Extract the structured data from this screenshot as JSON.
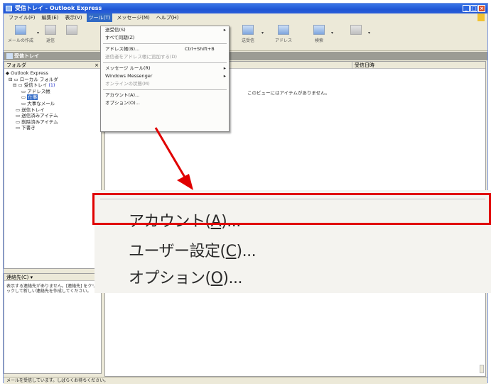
{
  "window": {
    "title": "受信トレイ - Outlook Express",
    "minimize": "_",
    "maximize": "□",
    "close": "×"
  },
  "menubar": {
    "items": [
      "ファイル(F)",
      "編集(E)",
      "表示(V)",
      "ツール(T)",
      "メッセージ(M)",
      "ヘルプ(H)"
    ]
  },
  "toolbar": {
    "buttons": [
      {
        "label": "メールの作成",
        "icon": "compose-icon"
      },
      {
        "label": "返信",
        "icon": "reply-icon"
      },
      {
        "label": "",
        "icon": "reply-all-icon"
      },
      {
        "label": "送受信",
        "icon": "send-receive-icon"
      },
      {
        "label": "アドレス",
        "icon": "address-book-icon"
      },
      {
        "label": "検索",
        "icon": "find-icon"
      },
      {
        "label": "",
        "icon": "dial-icon"
      }
    ]
  },
  "folderbar": {
    "label": "受信トレイ"
  },
  "folder_pane": {
    "header": "フォルダ",
    "close": "×",
    "tree": [
      {
        "label": "Outlook Express",
        "level": 0
      },
      {
        "label": "ローカル フォルダ",
        "level": 1
      },
      {
        "label": "受信トレイ",
        "count": "(1)",
        "level": 2
      },
      {
        "label": "アドレス帳",
        "level": 3
      },
      {
        "label": "仕事",
        "level": 3,
        "selected": true
      },
      {
        "label": "大事なメール",
        "level": 3
      },
      {
        "label": "送信トレイ",
        "level": 2
      },
      {
        "label": "送信済みアイテム",
        "level": 2
      },
      {
        "label": "削除済みアイテム",
        "level": 2
      },
      {
        "label": "下書き",
        "level": 2
      }
    ]
  },
  "contact_pane": {
    "header": "連絡先(C) ▾",
    "body": "表示する連絡先がありません。[連絡先] をクリックして新しい連絡先を作成してください。"
  },
  "list_pane": {
    "col_date": "受信日時",
    "empty_text": "このビューにはアイテムがありません。"
  },
  "statusbar": {
    "text": "メールを受信しています。しばらくお待ちください。"
  },
  "tools_menu": {
    "items": [
      {
        "label": "送受信(S)",
        "submenu": true
      },
      {
        "label": "すべて同期(Z)"
      },
      {
        "separator": true
      },
      {
        "label": "アドレス帳(B)...",
        "shortcut": "Ctrl+Shift+B"
      },
      {
        "label": "送信者をアドレス帳に追加する(D)",
        "disabled": true
      },
      {
        "separator": true
      },
      {
        "label": "メッセージ ルール(R)",
        "submenu": true
      },
      {
        "label": "Windows Messenger",
        "submenu": true
      },
      {
        "label": "オンラインの状態(M)",
        "disabled": true
      },
      {
        "separator": true
      },
      {
        "label": "アカウント(A)..."
      },
      {
        "label": "オプション(O)..."
      }
    ]
  },
  "zoom_callout": {
    "account": {
      "pre": "アカウント(",
      "key": "A",
      "post": ")..."
    },
    "user_settings": {
      "pre": "ユーザー設定(",
      "key": "C",
      "post": ")..."
    },
    "options": {
      "pre": "オプション(",
      "key": "O",
      "post": ")..."
    }
  },
  "colors": {
    "highlight": "#e00000",
    "arrow": "#e00000",
    "selection": "#316ac5"
  }
}
